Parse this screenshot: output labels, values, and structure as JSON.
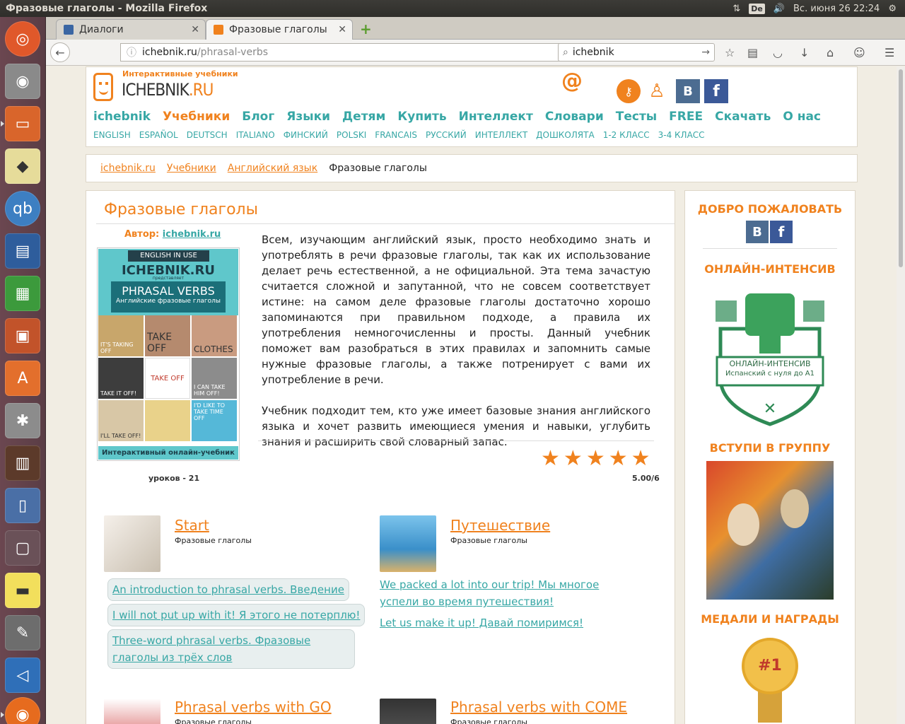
{
  "system": {
    "window_title": "Фразовые глаголы - Mozilla Firefox",
    "lang": "De",
    "datetime": "Вс. июня 26 22:24"
  },
  "tabs": [
    {
      "title": "Диалоги",
      "icon_color": "#3b66a3"
    },
    {
      "title": "Фразовые глаголы",
      "icon_color": "#f0821e"
    }
  ],
  "url": {
    "host": "ichebnik.ru",
    "path": "/phrasal-verbs"
  },
  "search": {
    "value": "ichebnik"
  },
  "site": {
    "logo_sub": "Интерактивные учебники",
    "logo_part1": "ICHEBNIK",
    "logo_part2": ".RU",
    "at_sign": "@",
    "vk_label": "В",
    "fb_label": "f"
  },
  "main_nav": [
    "ichebnik",
    "Учебники",
    "Блог",
    "Языки",
    "Детям",
    "Купить",
    "Интеллект",
    "Словари",
    "Тесты",
    "FREE",
    "Скачать",
    "О нас"
  ],
  "sub_nav": [
    "ENGLISH",
    "ESPAÑOL",
    "DEUTSCH",
    "ITALIANO",
    "ФИНСКИЙ",
    "POLSKI",
    "FRANCAIS",
    "РУССКИЙ",
    "ИНТЕЛЛЕКТ",
    "ДОШКОЛЯТА",
    "1-2 КЛАСС",
    "3-4 КЛАСС"
  ],
  "breadcrumbs": [
    "ichebnik.ru",
    "Учебники",
    "Английский язык",
    "Фразовые глаголы"
  ],
  "page": {
    "title": "Фразовые глаголы",
    "author_label": "Автор:",
    "author_name": "ichebnik.ru",
    "cover": {
      "strip": "ENGLISH IN USE",
      "brand": "ICHEBNIK.RU",
      "presents": "представляет",
      "title": "PHRASAL VERBS",
      "subtitle": "Английские фразовые глаголы",
      "cells": [
        "IT'S TAKING OFF",
        "TAKE OFF",
        "CLOTHES",
        "TAKE IT OFF!",
        "TAKE OFF",
        "I CAN TAKE HIM OFF!",
        "I'LL TAKE OFF!",
        "",
        "I'D LIKE TO TAKE TIME OFF"
      ],
      "bottom": "Интерактивный онлайн-учебник"
    },
    "description": [
      "Всем, изучающим английский язык, просто необходимо знать и употреблять в речи фразовые глаголы, так как их использование делает речь естественной, а не официальной. Эта тема зачастую считается сложной и запутанной, что не совсем соответствует истине: на самом деле фразовые глаголы достаточно хорошо запоминаются при правильном подходе, а правила их употребления немногочисленны и просты. Данный учебник поможет вам разобраться в этих правилах и запомнить самые нужные фразовые глаголы, а также потренирует с вами их употребление в речи.",
      "Учебник подходит тем, кто уже имеет базовые знания английского языка и хочет развить имеющиеся умения и навыки, углубить знания и расширить свой словарный запас."
    ],
    "rating": 5,
    "lessons_count": "уроков - 21",
    "score": "5.00/6"
  },
  "lessons": [
    {
      "title": "Start",
      "subtitle": "Фразовые глаголы",
      "links": [
        "An introduction to phrasal verbs. Введение",
        "I will not put up with it! Я этого не потерплю!",
        "Three-word phrasal verbs. Фразовые глаголы из трёх слов"
      ]
    },
    {
      "title": "Путешествие",
      "subtitle": "Фразовые глаголы",
      "links": [
        "We packed a lot into our trip! Мы многое успели во время путешествия!",
        "Let us make it up! Давай помиримся!"
      ]
    },
    {
      "title": "Phrasal verbs with GO",
      "subtitle": "Фразовые глаголы"
    },
    {
      "title": "Phrasal verbs with COME",
      "subtitle": "Фразовые глаголы"
    }
  ],
  "sidebar": {
    "welcome": "ДОБРО ПОЖАЛОВАТЬ",
    "intensive": "ОНЛАЙН-ИНТЕНСИВ",
    "badge_line1": "ОНЛАЙН-ИНТЕНСИВ",
    "badge_line2": "Испанский с нуля до А1",
    "group": "ВСТУПИ В ГРУППУ",
    "medals": "МЕДАЛИ И НАГРАДЫ",
    "medal_text": "#1"
  },
  "colors": {
    "accent": "#f0821e",
    "teal": "#37a7a5",
    "vk": "#4c6c91",
    "fb": "#3b5998"
  }
}
